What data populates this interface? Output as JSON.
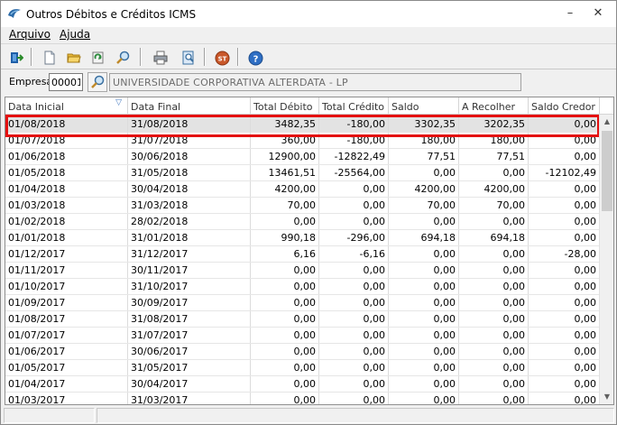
{
  "window": {
    "title": "Outros Débitos e Créditos ICMS",
    "minimize_glyph": "–",
    "close_glyph": "✕"
  },
  "menu": {
    "arquivo": "Arquivo",
    "ajuda": "Ajuda"
  },
  "toolbar": {
    "buttons": [
      "exit-icon",
      "new-document-icon",
      "open-folder-icon",
      "refresh-icon",
      "search-icon",
      "print-icon",
      "print-preview-icon",
      "st-icon",
      "help-icon"
    ],
    "st_label": "ST",
    "help_label": "?"
  },
  "empresa": {
    "label": "Empresa",
    "code": "00001",
    "name": "UNIVERSIDADE CORPORATIVA ALTERDATA - LP"
  },
  "grid": {
    "columns": [
      "Data Inicial",
      "Data Final",
      "Total Débito",
      "Total Crédito",
      "Saldo",
      "A Recolher",
      "Saldo Credor"
    ],
    "sort_glyph": "▽",
    "rows": [
      [
        "01/08/2018",
        "31/08/2018",
        "3482,35",
        "-180,00",
        "3302,35",
        "3202,35",
        "0,00"
      ],
      [
        "01/07/2018",
        "31/07/2018",
        "360,00",
        "-180,00",
        "180,00",
        "180,00",
        "0,00"
      ],
      [
        "01/06/2018",
        "30/06/2018",
        "12900,00",
        "-12822,49",
        "77,51",
        "77,51",
        "0,00"
      ],
      [
        "01/05/2018",
        "31/05/2018",
        "13461,51",
        "-25564,00",
        "0,00",
        "0,00",
        "-12102,49"
      ],
      [
        "01/04/2018",
        "30/04/2018",
        "4200,00",
        "0,00",
        "4200,00",
        "4200,00",
        "0,00"
      ],
      [
        "01/03/2018",
        "31/03/2018",
        "70,00",
        "0,00",
        "70,00",
        "70,00",
        "0,00"
      ],
      [
        "01/02/2018",
        "28/02/2018",
        "0,00",
        "0,00",
        "0,00",
        "0,00",
        "0,00"
      ],
      [
        "01/01/2018",
        "31/01/2018",
        "990,18",
        "-296,00",
        "694,18",
        "694,18",
        "0,00"
      ],
      [
        "01/12/2017",
        "31/12/2017",
        "6,16",
        "-6,16",
        "0,00",
        "0,00",
        "-28,00"
      ],
      [
        "01/11/2017",
        "30/11/2017",
        "0,00",
        "0,00",
        "0,00",
        "0,00",
        "0,00"
      ],
      [
        "01/10/2017",
        "31/10/2017",
        "0,00",
        "0,00",
        "0,00",
        "0,00",
        "0,00"
      ],
      [
        "01/09/2017",
        "30/09/2017",
        "0,00",
        "0,00",
        "0,00",
        "0,00",
        "0,00"
      ],
      [
        "01/08/2017",
        "31/08/2017",
        "0,00",
        "0,00",
        "0,00",
        "0,00",
        "0,00"
      ],
      [
        "01/07/2017",
        "31/07/2017",
        "0,00",
        "0,00",
        "0,00",
        "0,00",
        "0,00"
      ],
      [
        "01/06/2017",
        "30/06/2017",
        "0,00",
        "0,00",
        "0,00",
        "0,00",
        "0,00"
      ],
      [
        "01/05/2017",
        "31/05/2017",
        "0,00",
        "0,00",
        "0,00",
        "0,00",
        "0,00"
      ],
      [
        "01/04/2017",
        "30/04/2017",
        "0,00",
        "0,00",
        "0,00",
        "0,00",
        "0,00"
      ],
      [
        "01/03/2017",
        "31/03/2017",
        "0,00",
        "0,00",
        "0,00",
        "0,00",
        "0,00"
      ]
    ],
    "selected_row": 0,
    "highlight_color": "#e41010",
    "scroll_up_glyph": "▲",
    "scroll_down_glyph": "▼"
  }
}
